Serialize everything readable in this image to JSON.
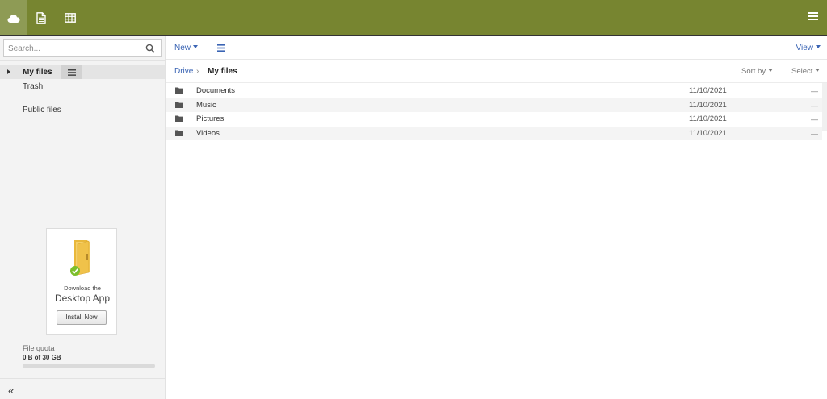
{
  "topbar": {
    "apps": [
      {
        "name": "drive",
        "icon": "cloud-icon"
      },
      {
        "name": "docs",
        "icon": "document-icon"
      },
      {
        "name": "sheets",
        "icon": "spreadsheet-icon"
      }
    ],
    "menu_icon": "hamburger-menu-icon",
    "color": "#778530"
  },
  "sidebar": {
    "search": {
      "placeholder": "Search...",
      "value": ""
    },
    "nav": {
      "my_files": "My files",
      "trash": "Trash",
      "public_files": "Public files"
    },
    "promo": {
      "line1": "Download the",
      "line2": "Desktop App",
      "button": "Install Now"
    },
    "quota": {
      "label": "File quota",
      "value": "0 B of 30 GB",
      "used_fraction": 0
    },
    "collapse_label": "«"
  },
  "toolbar": {
    "new_label": "New",
    "view_label": "View"
  },
  "breadcrumb": {
    "root": "Drive",
    "separator": "›",
    "current": "My files",
    "sort_label": "Sort by",
    "select_label": "Select"
  },
  "files": [
    {
      "name": "Documents",
      "date": "11/10/2021",
      "size": "—"
    },
    {
      "name": "Music",
      "date": "11/10/2021",
      "size": "—"
    },
    {
      "name": "Pictures",
      "date": "11/10/2021",
      "size": "—"
    },
    {
      "name": "Videos",
      "date": "11/10/2021",
      "size": "—"
    }
  ],
  "colors": {
    "accent": "#778530",
    "link": "#3a64b4",
    "sidebar_bg": "#f3f3f3"
  }
}
